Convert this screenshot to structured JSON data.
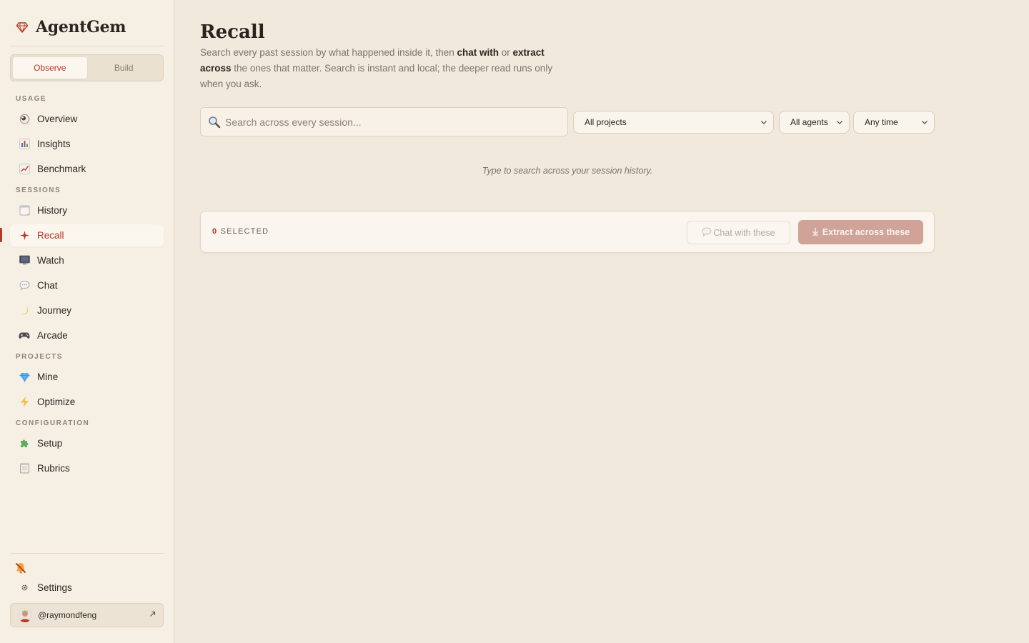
{
  "brand": {
    "name": "AgentGem"
  },
  "mode_toggle": {
    "observe": "Observe",
    "build": "Build",
    "active": "observe"
  },
  "sidebar": {
    "sections": [
      {
        "label": "USAGE",
        "items": [
          {
            "label": "Overview",
            "icon": "eye-icon"
          },
          {
            "label": "Insights",
            "icon": "bar-chart-icon"
          },
          {
            "label": "Benchmark",
            "icon": "line-chart-icon"
          }
        ]
      },
      {
        "label": "SESSIONS",
        "items": [
          {
            "label": "History",
            "icon": "notepad-icon"
          },
          {
            "label": "Recall",
            "icon": "sparkle-icon",
            "active": true
          },
          {
            "label": "Watch",
            "icon": "monitor-icon"
          },
          {
            "label": "Chat",
            "icon": "speech-bubble-icon"
          },
          {
            "label": "Journey",
            "icon": "crescent-moon-icon"
          },
          {
            "label": "Arcade",
            "icon": "gamepad-icon"
          }
        ]
      },
      {
        "label": "PROJECTS",
        "items": [
          {
            "label": "Mine",
            "icon": "gem-icon"
          },
          {
            "label": "Optimize",
            "icon": "lightning-icon"
          }
        ]
      },
      {
        "label": "CONFIGURATION",
        "items": [
          {
            "label": "Setup",
            "icon": "puzzle-icon"
          },
          {
            "label": "Rubrics",
            "icon": "clipboard-icon"
          }
        ]
      }
    ],
    "settings_label": "Settings",
    "user": {
      "handle": "@raymondfeng"
    }
  },
  "main": {
    "title": "Recall",
    "description": {
      "part1": "Search every past session by what happened inside it, then ",
      "bold1": "chat with",
      "part2": " or ",
      "bold2": "extract across",
      "part3": " the ones that matter. Search is instant and local; the deeper read runs only when you ask."
    },
    "search": {
      "placeholder": "Search across every session..."
    },
    "filters": {
      "project": "All projects",
      "agent": "All agents",
      "time": "Any time"
    },
    "hint": "Type to search across your session history.",
    "selection": {
      "count": "0",
      "label": "SELECTED",
      "chat_button": "Chat with these",
      "extract_button": "Extract across these"
    }
  },
  "colors": {
    "accent": "#b23a26",
    "background": "#f1e9dc",
    "sidebar": "#f6efe4"
  }
}
